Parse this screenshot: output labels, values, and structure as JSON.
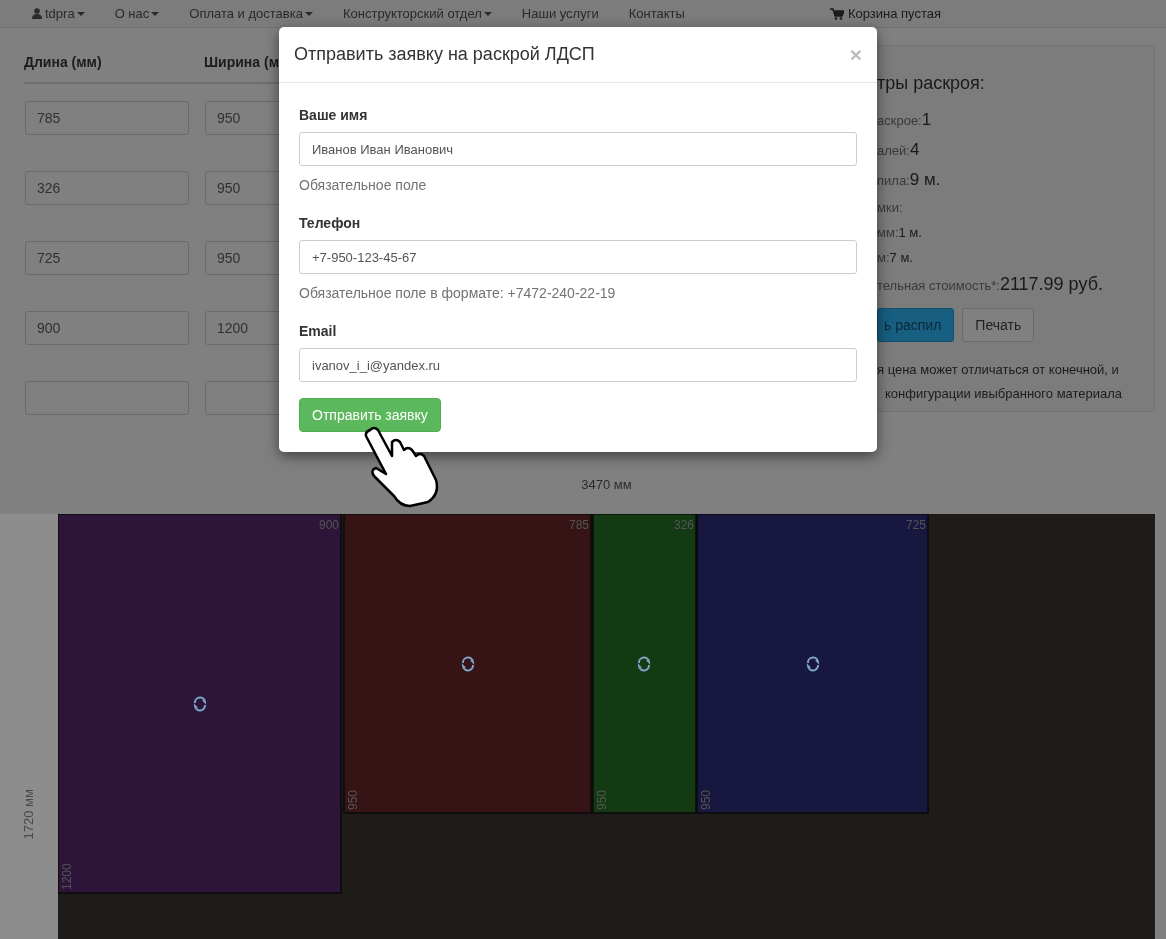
{
  "navbar": {
    "items": [
      {
        "label": "tdpra",
        "dropdown": true,
        "kind": "user"
      },
      {
        "label": "О нас",
        "dropdown": true
      },
      {
        "label": "Оплата и доставка",
        "dropdown": true
      },
      {
        "label": "Конструкторский отдел",
        "dropdown": true
      },
      {
        "label": "Наши услуги",
        "dropdown": false
      },
      {
        "label": "Контакты",
        "dropdown": false
      }
    ],
    "cart": {
      "label": "Корзина пустая"
    }
  },
  "table": {
    "columns": [
      "Длина (мм)",
      "Ширина (м"
    ],
    "rows": [
      [
        "785",
        "950"
      ],
      [
        "326",
        "950"
      ],
      [
        "725",
        "950"
      ],
      [
        "900",
        "1200"
      ],
      [
        "",
        ""
      ]
    ]
  },
  "summary": {
    "title": "тры раскроя:",
    "lines": [
      {
        "kind": "main",
        "label": "аскрое:",
        "value": "1"
      },
      {
        "kind": "main",
        "label": "алей:",
        "value": "4"
      },
      {
        "kind": "main",
        "label": "пила:",
        "value": "9 м."
      },
      {
        "kind": "sub",
        "label": "мки:"
      },
      {
        "kind": "sub",
        "label": "мм:",
        "value": "1 м."
      },
      {
        "kind": "sub",
        "label": "м:",
        "value": "7 м."
      },
      {
        "kind": "total",
        "label": "тельная стоимость*:",
        "value": "2117.99 руб."
      }
    ],
    "buttons": [
      {
        "label": "ь распил",
        "kind": "primary"
      },
      {
        "label": "Печать",
        "kind": "default"
      }
    ],
    "note": [
      "я цена может отличаться от конечной, и",
      "конфигурации ивыбранного материала"
    ]
  },
  "layout": {
    "width_label": "3470 мм",
    "height_label": "1720 мм",
    "pieces": [
      {
        "top_label": "900",
        "side_label": "1200",
        "color": "#2d1439"
      },
      {
        "top_label": "785",
        "side_label": "950",
        "color": "#361415"
      },
      {
        "top_label": "326",
        "side_label": "950",
        "color": "#143a14"
      },
      {
        "top_label": "725",
        "side_label": "950",
        "color": "#17173f"
      }
    ]
  },
  "modal": {
    "title": "Отправить заявку на раскрой ЛДСП",
    "close": "×",
    "fields": [
      {
        "label": "Ваше имя",
        "value": "Иванов Иван Иванович",
        "help": "Обязательное поле"
      },
      {
        "label": "Телефон",
        "value": "+7-950-123-45-67",
        "help": "Обязательное поле в формате: +7472-240-22-19"
      },
      {
        "label": "Email",
        "value": "ivanov_i_i@yandex.ru"
      }
    ],
    "submit": "Отправить заявку"
  }
}
